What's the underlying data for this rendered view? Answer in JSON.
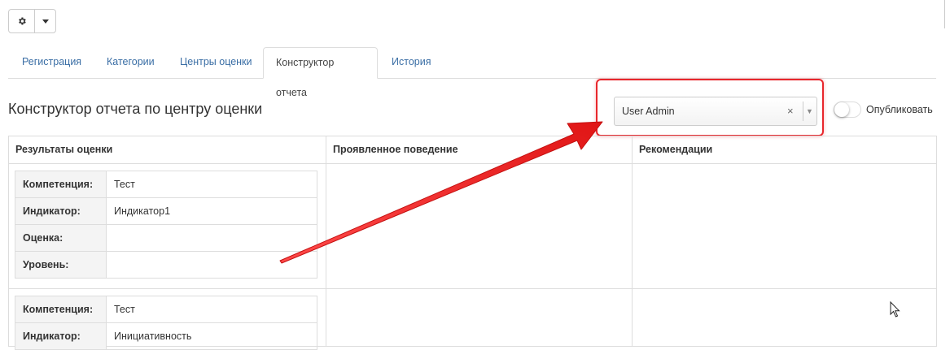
{
  "toolbar": {
    "gear_icon": "gear-icon",
    "dropdown_icon": "caret-down-icon"
  },
  "tabs": [
    {
      "label": "Регистрация",
      "active": false
    },
    {
      "label": "Категории",
      "active": false
    },
    {
      "label": "Центры оценки",
      "active": false
    },
    {
      "label": "Конструктор отчета",
      "active": true
    },
    {
      "label": "История",
      "active": false
    }
  ],
  "page": {
    "title": "Конструктор отчета по центру оценки"
  },
  "user_select": {
    "value": "User Admin",
    "clear_symbol": "×",
    "arrow_symbol": "▼"
  },
  "publish": {
    "label": "Опубликовать",
    "checked": false
  },
  "table": {
    "headers": [
      "Результаты оценки",
      "Проявленное поведение",
      "Рекомендации"
    ],
    "rows": [
      {
        "fields": [
          {
            "key": "Компетенция:",
            "value": "Тест"
          },
          {
            "key": "Индикатор:",
            "value": "Индикатор1"
          },
          {
            "key": "Оценка:",
            "value": ""
          },
          {
            "key": "Уровень:",
            "value": ""
          }
        ]
      },
      {
        "fields": [
          {
            "key": "Компетенция:",
            "value": "Тест"
          },
          {
            "key": "Индикатор:",
            "value": "Инициативность"
          }
        ]
      }
    ]
  },
  "colors": {
    "annotation": "#e8262c",
    "link": "#3a6ea5",
    "border": "#dddddd"
  }
}
